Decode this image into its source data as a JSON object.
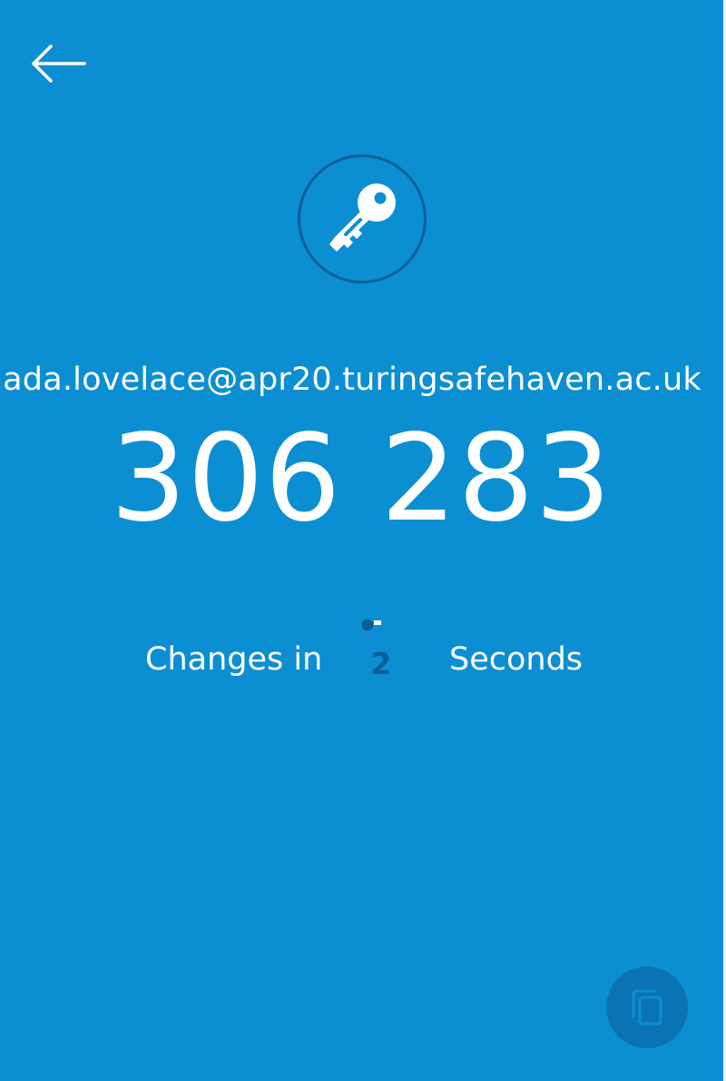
{
  "nav": {
    "back_icon": "arrow-left-icon"
  },
  "account": {
    "icon": "key-icon",
    "email": "ada.lovelace@apr20.turingsafehaven.ac.uk"
  },
  "code": {
    "value": "306 283"
  },
  "timer": {
    "prefix": "Changes in",
    "seconds_remaining": "2",
    "suffix": "Seconds"
  },
  "actions": {
    "copy_icon": "copy-icon"
  },
  "colors": {
    "background": "#0c8fd2",
    "accent_dark": "#0a5f97",
    "fab": "#0a73b3",
    "text": "#ffffff"
  }
}
